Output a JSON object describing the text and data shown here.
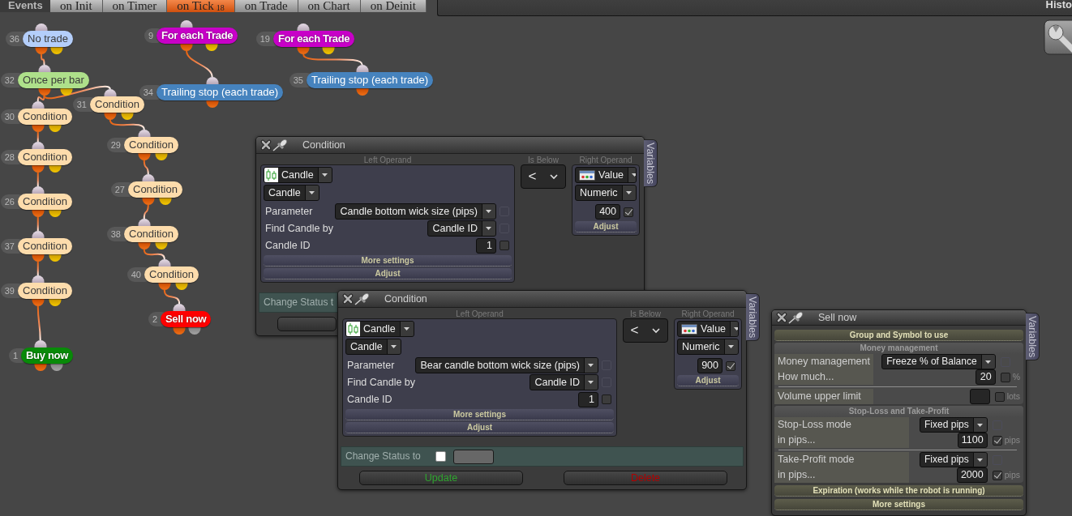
{
  "tab_bar": {
    "title": "Events",
    "tabs": [
      {
        "label": "on Init",
        "selected": false
      },
      {
        "label": "on Timer",
        "selected": false
      },
      {
        "label": "on Tick",
        "count": "18",
        "selected": true
      },
      {
        "label": "on Trade",
        "selected": false
      },
      {
        "label": "on Chart",
        "selected": false
      },
      {
        "label": "on Deinit",
        "selected": false
      }
    ]
  },
  "side_panel": {
    "title": "Histo"
  },
  "flowchart": {
    "nodes": [
      {
        "number": "36",
        "label": "No trade",
        "kind": "logic",
        "color": "#b4cefa",
        "children": [
          {
            "number": "32",
            "label": "Once per bar",
            "kind": "logic",
            "color": "#aee08a",
            "children": [
              {
                "number": "30",
                "label": "Condition",
                "kind": "logic",
                "color": "#fddcac",
                "children": [
                  {
                    "number": "28",
                    "label": "Condition",
                    "kind": "logic",
                    "color": "#fddcac",
                    "children": [
                      {
                        "number": "26",
                        "label": "Condition",
                        "kind": "logic",
                        "color": "#fddcac",
                        "children": [
                          {
                            "number": "37",
                            "label": "Condition",
                            "kind": "logic",
                            "color": "#fddcac",
                            "children": [
                              {
                                "number": "39",
                                "label": "Condition",
                                "kind": "logic",
                                "color": "#fddcac",
                                "children": [
                                  {
                                    "number": "1",
                                    "label": "Buy now",
                                    "kind": "trade",
                                    "color": "#088a08"
                                  }
                                ]
                              }
                            ]
                          }
                        ]
                      }
                    ]
                  }
                ]
              },
              {
                "number": "31",
                "label": "Condition",
                "kind": "logic",
                "color": "#fddcac",
                "children": [
                  {
                    "number": "29",
                    "label": "Condition",
                    "kind": "logic",
                    "color": "#fddcac",
                    "children": [
                      {
                        "number": "27",
                        "label": "Condition",
                        "kind": "logic",
                        "color": "#fddcac",
                        "children": [
                          {
                            "number": "38",
                            "label": "Condition",
                            "kind": "logic",
                            "color": "#fddcac",
                            "children": [
                              {
                                "number": "40",
                                "label": "Condition",
                                "kind": "logic",
                                "color": "#fddcac",
                                "children": [
                                  {
                                    "number": "2",
                                    "label": "Sell now",
                                    "kind": "trade",
                                    "color": "#ff0000"
                                  }
                                ]
                              }
                            ]
                          }
                        ]
                      }
                    ]
                  }
                ]
              }
            ]
          }
        ]
      },
      {
        "number": "9",
        "label": "For each Trade",
        "kind": "logic",
        "color": "#c800c8",
        "children": [
          {
            "number": "34",
            "label": "Trailing stop (each trade)",
            "kind": "action",
            "color": "#4683be"
          }
        ]
      },
      {
        "number": "19",
        "label": "For each Trade",
        "kind": "logic",
        "color": "#c800c8",
        "children": [
          {
            "number": "35",
            "label": "Trailing stop (each trade)",
            "kind": "action",
            "color": "#4683be"
          }
        ]
      }
    ]
  },
  "windows": [
    {
      "kind": "condition",
      "title": "Condition",
      "side_tab": "Variables",
      "left_operand": {
        "heading": "Left Operand",
        "source": "Candle",
        "type": "Candle",
        "fields": [
          {
            "label": "Parameter",
            "kind": "select",
            "value": "Candle bottom wick size (pips)",
            "checked": false,
            "disabled": true
          },
          {
            "label": "Find Candle by",
            "kind": "select",
            "value": "Candle ID",
            "checked": false,
            "disabled": true
          },
          {
            "label": "Candle ID",
            "kind": "input",
            "value": "1",
            "checked": false,
            "disabled": false
          }
        ],
        "buttons": [
          "More settings",
          "Adjust"
        ]
      },
      "operator": {
        "heading": "Is Below",
        "symbol": "<"
      },
      "right_operand": {
        "heading": "Right Operand",
        "source": "Value",
        "type": "Numeric",
        "value": "400",
        "checked": true,
        "button": "Adjust"
      },
      "status": {
        "label": "Change Status t"
      },
      "blank_button": true
    },
    {
      "kind": "condition",
      "title": "Condition",
      "side_tab": "Variables",
      "left_operand": {
        "heading": "Left Operand",
        "source": "Candle",
        "type": "Candle",
        "fields": [
          {
            "label": "Parameter",
            "kind": "select",
            "value": "Bear candle bottom wick size (pips)",
            "checked": false,
            "disabled": true
          },
          {
            "label": "Find Candle by",
            "kind": "select",
            "value": "Candle ID",
            "checked": false,
            "disabled": true
          },
          {
            "label": "Candle ID",
            "kind": "input",
            "value": "1",
            "checked": false,
            "disabled": false
          }
        ],
        "buttons": [
          "More settings",
          "Adjust"
        ]
      },
      "operator": {
        "heading": "Is Below",
        "symbol": "<"
      },
      "right_operand": {
        "heading": "Right Operand",
        "source": "Value",
        "type": "Numeric",
        "value": "900",
        "checked": true,
        "button": "Adjust"
      },
      "status": {
        "label": "Change Status to",
        "checked": false
      },
      "actions": [
        {
          "label": "Update",
          "kind": "confirm"
        },
        {
          "label": "Delete",
          "kind": "danger"
        }
      ]
    },
    {
      "kind": "trade",
      "title": "Sell now",
      "side_tab": "Variables",
      "sections": [
        {
          "kind": "bar",
          "title": "Group and Symbol to use"
        },
        {
          "kind": "group",
          "title": "Money management",
          "blocks": [
            [
              {
                "label": "Money management",
                "kind": "select",
                "value": "Freeze % of Balance",
                "checked": false,
                "disabled": true
              },
              {
                "label": "How much...",
                "kind": "input",
                "value": "20",
                "checked": false,
                "disabled": false,
                "unit": "%"
              }
            ],
            [
              {
                "label": "Volume upper limit",
                "kind": "input",
                "checked": false,
                "disabled": false,
                "unit": "lots"
              }
            ]
          ]
        },
        {
          "kind": "group",
          "title": "Stop-Loss and Take-Profit",
          "blocks": [
            [
              {
                "label": "Stop-Loss mode",
                "kind": "select",
                "value": "Fixed pips",
                "checked": false,
                "disabled": true
              },
              {
                "label": "in pips...",
                "kind": "input",
                "value": "1100",
                "checked": true,
                "disabled": false,
                "unit": "pips"
              }
            ],
            [
              {
                "label": "Take-Profit mode",
                "kind": "select",
                "value": "Fixed pips",
                "checked": false,
                "disabled": true
              },
              {
                "label": "in pips...",
                "kind": "input",
                "value": "2000",
                "checked": true,
                "disabled": false,
                "unit": "pips"
              }
            ]
          ]
        },
        {
          "kind": "bar",
          "title": "Expiration (works while the robot is running)"
        },
        {
          "kind": "bar",
          "title": "More settings"
        }
      ]
    }
  ]
}
